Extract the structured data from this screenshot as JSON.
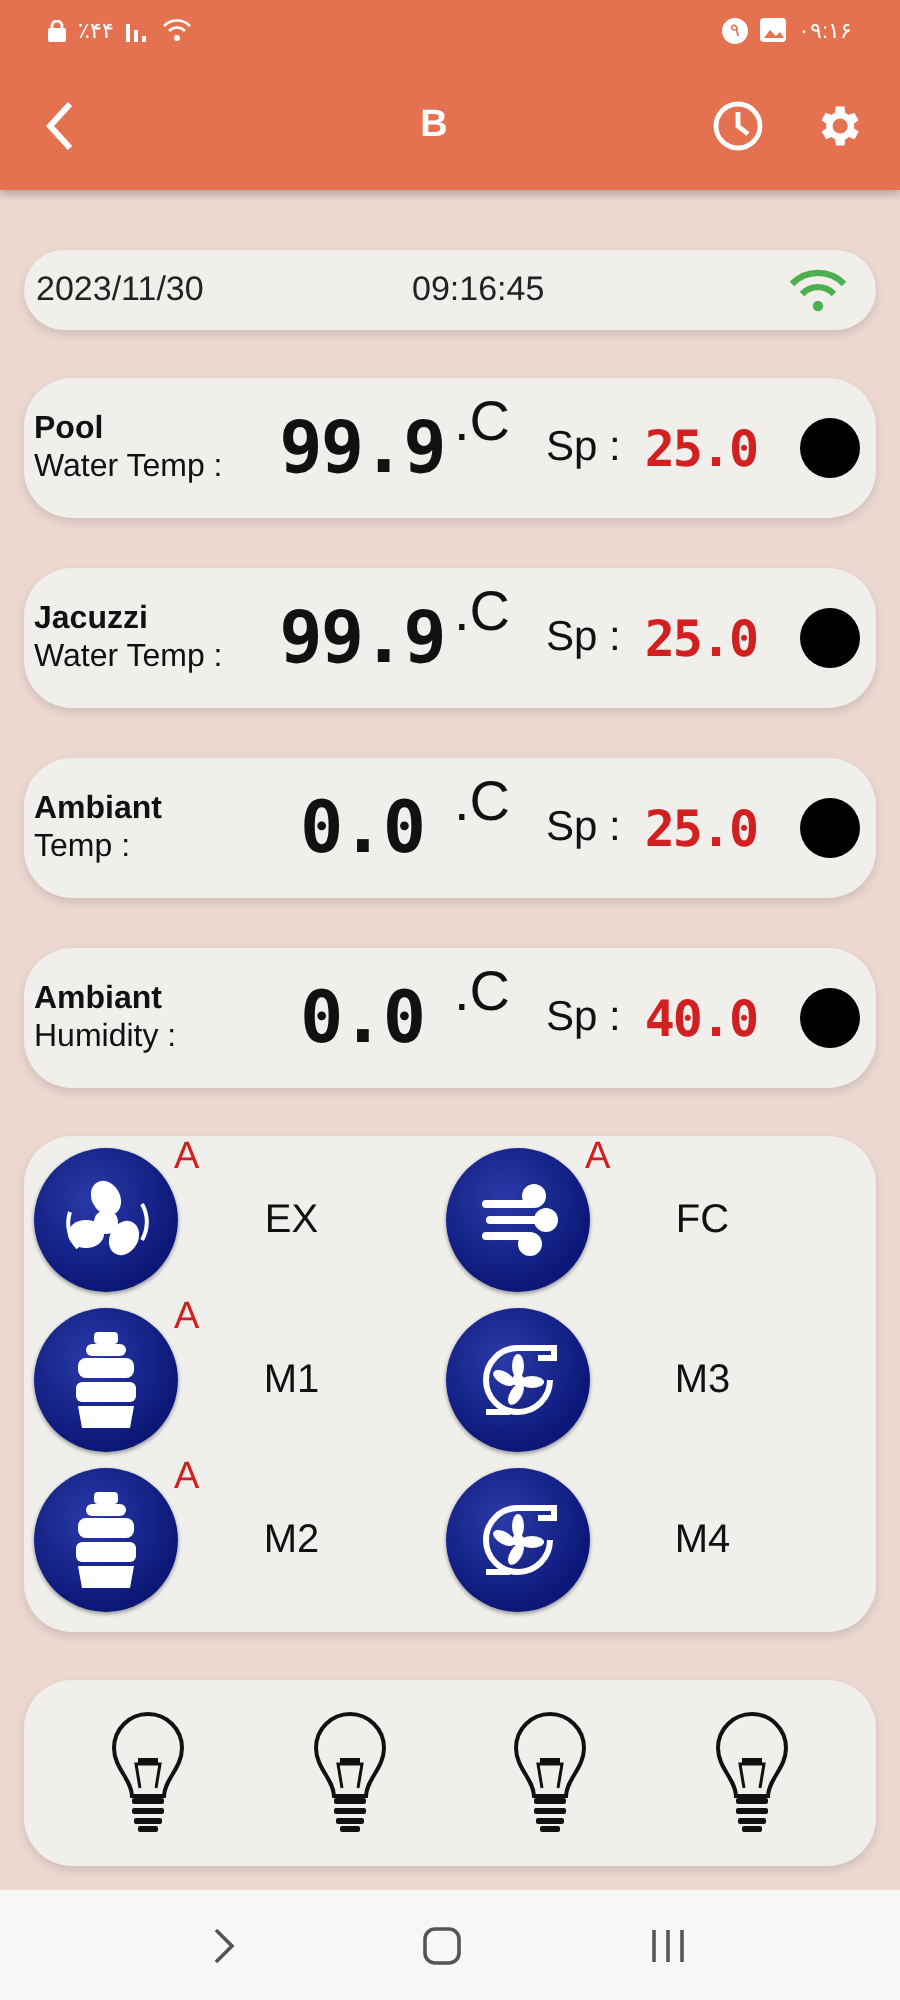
{
  "status_bar": {
    "left": "٪۴۴",
    "badge": "۹",
    "time": "۰۹:۱۶"
  },
  "app_bar": {
    "title": "B"
  },
  "info": {
    "date": "2023/11/30",
    "time": "09:16:45"
  },
  "sensors": [
    {
      "name": "Pool",
      "label": "Water Temp :",
      "value": "99.9",
      "unit": ".C",
      "sp_label": "Sp :",
      "setpoint": "25.0"
    },
    {
      "name": "Jacuzzi",
      "label": "Water Temp :",
      "value": "99.9",
      "unit": ".C",
      "sp_label": "Sp :",
      "setpoint": "25.0"
    },
    {
      "name": "Ambiant",
      "label": "Temp :",
      "value": "0.0",
      "unit": ".C",
      "sp_label": "Sp :",
      "setpoint": "25.0"
    },
    {
      "name": "Ambiant",
      "label": "Humidity :",
      "value": "0.0",
      "unit": ".C",
      "sp_label": "Sp :",
      "setpoint": "40.0"
    }
  ],
  "equipment": [
    {
      "kind": "fan",
      "badge": "A",
      "label": "EX"
    },
    {
      "kind": "blower",
      "badge": "A",
      "label": "FC"
    },
    {
      "kind": "tank",
      "badge": "A",
      "label": "M1"
    },
    {
      "kind": "pump",
      "label": "M3"
    },
    {
      "kind": "tank",
      "badge": "A",
      "label": "M2"
    },
    {
      "kind": "pump",
      "label": "M4"
    }
  ],
  "lights": [
    {
      "on": false
    },
    {
      "on": false
    },
    {
      "on": false
    },
    {
      "on": false
    }
  ]
}
